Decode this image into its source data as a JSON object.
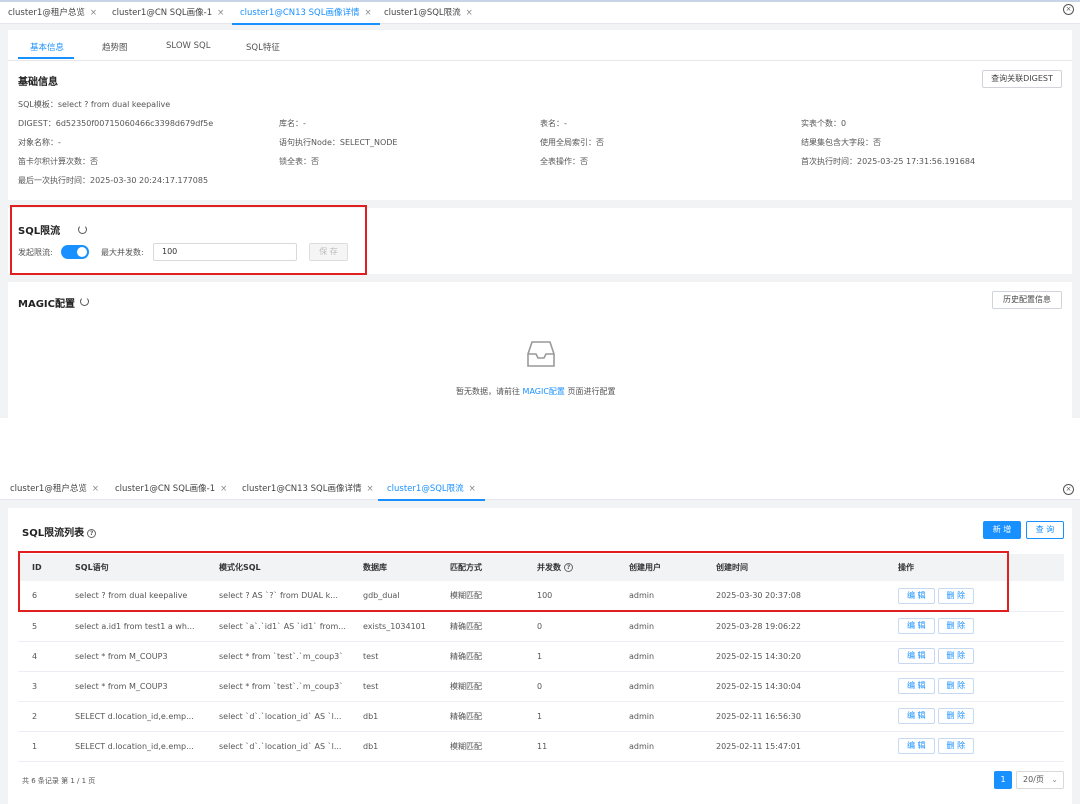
{
  "top_tabs": [
    {
      "label": "cluster1@租户总览"
    },
    {
      "label": "cluster1@CN SQL画像-1"
    },
    {
      "label": "cluster1@CN13 SQL画像详情"
    },
    {
      "label": "cluster1@SQL限流"
    }
  ],
  "bottom_tabs": [
    {
      "label": "cluster1@租户总览"
    },
    {
      "label": "cluster1@CN SQL画像-1"
    },
    {
      "label": "cluster1@CN13 SQL画像详情"
    },
    {
      "label": "cluster1@SQL限流"
    }
  ],
  "tab_close": "×",
  "close_all": "×",
  "sub_tabs": [
    {
      "label": "基本信息"
    },
    {
      "label": "趋势图"
    },
    {
      "label": "SLOW SQL"
    },
    {
      "label": "SQL特征"
    }
  ],
  "basic_info": {
    "title": "基础信息",
    "digest_button": "查询关联DIGEST",
    "sql_template": "SQL模板：select ? from dual keepalive",
    "fields": [
      "DIGEST：6d52350f00715060466c3398d679df5e",
      "库名：-",
      "表名：-",
      "实表个数：0",
      "对象名称：-",
      "语句执行Node：SELECT_NODE",
      "使用全局索引：否",
      "结果集包含大字段：否",
      "笛卡尔积计算次数：否",
      "锁全表：否",
      "全表操作：否",
      "首次执行时间：2025-03-25 17:31:56.191684",
      "最后一次执行时间：2025-03-30 20:24:17.177085"
    ]
  },
  "rate_limit": {
    "title": "SQL限流",
    "enable_label": "发起限流:",
    "enabled": true,
    "max_concurrency_label": "最大并发数:",
    "max_concurrency_value": "100",
    "save_button": "保 存"
  },
  "magic": {
    "title": "MAGIC配置",
    "history_button": "历史配置信息",
    "empty_prefix": "暂无数据，请前往",
    "empty_link": "MAGIC配置",
    "empty_suffix": "页面进行配置"
  },
  "list": {
    "title": "SQL限流列表",
    "new_button": "新 增",
    "query_button": "查 询",
    "columns": [
      "ID",
      "SQL语句",
      "模式化SQL",
      "数据库",
      "匹配方式",
      "并发数",
      "创建用户",
      "创建时间",
      "操作"
    ],
    "edit_label": "编 辑",
    "delete_label": "删 除",
    "rows": [
      {
        "id": "6",
        "sql": "select ? from dual keepalive",
        "pattern": "select ? AS `?` from DUAL k...",
        "db": "gdb_dual",
        "match": "模糊匹配",
        "concurrency": "100",
        "user": "admin",
        "created": "2025-03-30 20:37:08"
      },
      {
        "id": "5",
        "sql": "select a.id1 from test1 a wh...",
        "pattern": "select `a`.`id1` AS `id1` from...",
        "db": "exists_1034101",
        "match": "精确匹配",
        "concurrency": "0",
        "user": "admin",
        "created": "2025-03-28 19:06:22"
      },
      {
        "id": "4",
        "sql": "select * from M_COUP3",
        "pattern": "select * from `test`.`m_coup3`",
        "db": "test",
        "match": "精确匹配",
        "concurrency": "1",
        "user": "admin",
        "created": "2025-02-15 14:30:20"
      },
      {
        "id": "3",
        "sql": "select * from M_COUP3",
        "pattern": "select * from `test`.`m_coup3`",
        "db": "test",
        "match": "模糊匹配",
        "concurrency": "0",
        "user": "admin",
        "created": "2025-02-15 14:30:04"
      },
      {
        "id": "2",
        "sql": "SELECT d.location_id,e.emp...",
        "pattern": "select `d`.`location_id` AS `l...",
        "db": "db1",
        "match": "精确匹配",
        "concurrency": "1",
        "user": "admin",
        "created": "2025-02-11 16:56:30"
      },
      {
        "id": "1",
        "sql": "SELECT d.location_id,e.emp...",
        "pattern": "select `d`.`location_id` AS `l...",
        "db": "db1",
        "match": "模糊匹配",
        "concurrency": "11",
        "user": "admin",
        "created": "2025-02-11 15:47:01"
      }
    ],
    "summary": "共 6 条记录  第 1 / 1 页",
    "current_page": "1",
    "page_size": "20/页"
  },
  "colors": {
    "accent": "#1890ff",
    "highlight_box": "#e02020",
    "panel_bg": "#f2f3f5"
  }
}
